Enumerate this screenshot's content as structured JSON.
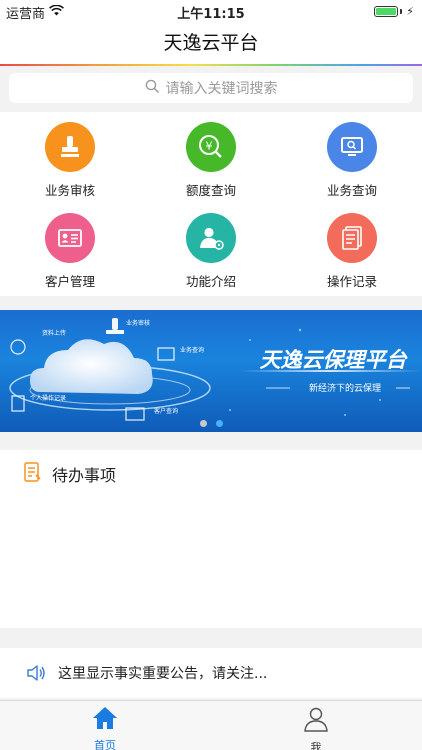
{
  "status_bar": {
    "carrier": "运营商",
    "time": "上午11:15"
  },
  "nav": {
    "title": "天逸云平台"
  },
  "search": {
    "placeholder": "请输入关键词搜索"
  },
  "grid": [
    {
      "label": "业务审核",
      "icon": "stamp-icon",
      "color": "#f7921e"
    },
    {
      "label": "额度查询",
      "icon": "yuan-search-icon",
      "color": "#46b82a"
    },
    {
      "label": "业务查询",
      "icon": "monitor-search-icon",
      "color": "#4a86e8"
    },
    {
      "label": "客户管理",
      "icon": "id-card-icon",
      "color": "#ef5f8b"
    },
    {
      "label": "功能介绍",
      "icon": "person-info-icon",
      "color": "#26b5a5"
    },
    {
      "label": "操作记录",
      "icon": "document-list-icon",
      "color": "#f26b5b"
    }
  ],
  "banner": {
    "title": "天逸云保理平台",
    "subtitle": "新经济下的云保理",
    "labels": [
      "业务审核",
      "业务查询",
      "客户查询",
      "资料上传",
      "个人操作记录"
    ],
    "dots": 2,
    "active_dot": 1
  },
  "todo": {
    "title": "待办事项"
  },
  "notice": {
    "text": "这里显示事实重要公告，请关注..."
  },
  "tabbar": {
    "tabs": [
      {
        "label": "首页",
        "icon": "home-icon",
        "active": true
      },
      {
        "label": "我",
        "icon": "person-icon",
        "active": false
      }
    ],
    "active_color": "#1a7be0",
    "inactive_color": "#333333"
  }
}
